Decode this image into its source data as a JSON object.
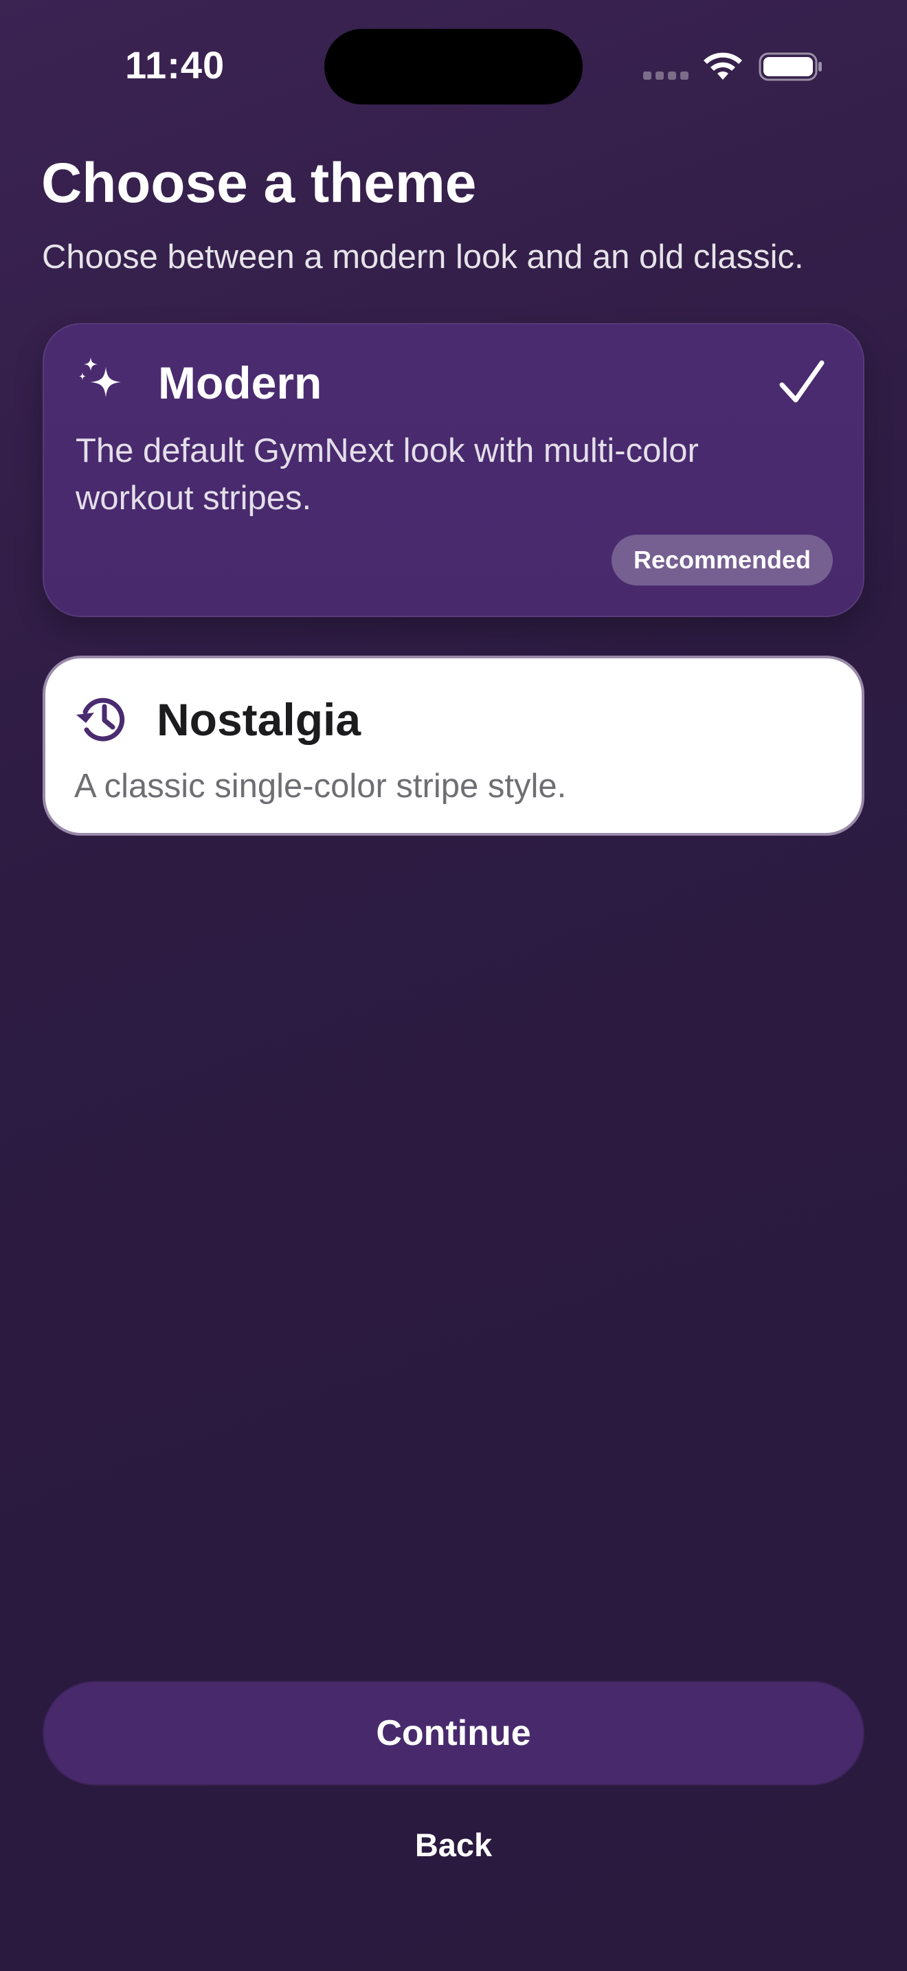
{
  "status_bar": {
    "time": "11:40"
  },
  "header": {
    "title": "Choose a theme",
    "subtitle": "Choose between a modern look and an old classic."
  },
  "themes": [
    {
      "title": "Modern",
      "description_line1": "The default GymNext look with multi-color",
      "description_line2": "workout stripes.",
      "badge": "Recommended",
      "selected": true,
      "icon": "sparkles-icon"
    },
    {
      "title": "Nostalgia",
      "description_line1": "A classic single-color stripe style.",
      "selected": false,
      "icon": "history-clock-icon"
    }
  ],
  "actions": {
    "continue_label": "Continue",
    "back_label": "Back"
  },
  "colors": {
    "background": "#2d1b42",
    "accent": "#482a6c",
    "nostalgia_icon": "#4a2b70",
    "nostalgia_title": "#1c1c1e",
    "nostalgia_desc": "#6e6e73"
  }
}
